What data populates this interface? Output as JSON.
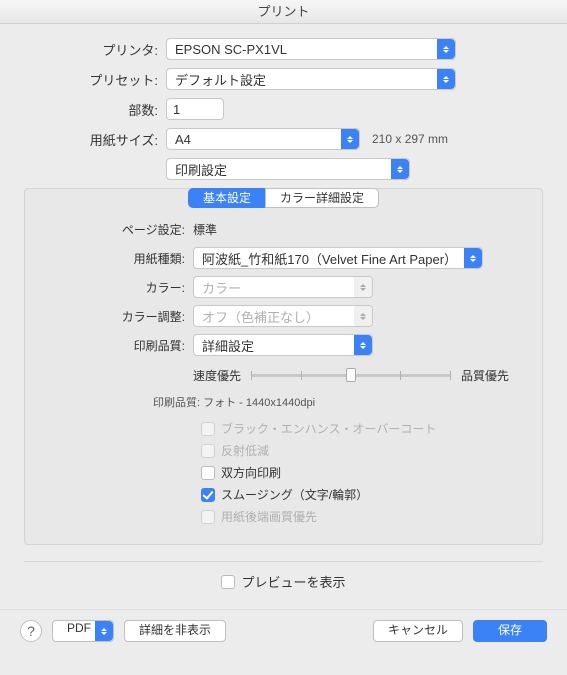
{
  "window": {
    "title": "プリント"
  },
  "labels": {
    "printer": "プリンタ:",
    "preset": "プリセット:",
    "copies": "部数:",
    "paper_size": "用紙サイズ:"
  },
  "printer": {
    "value": "EPSON SC-PX1VL"
  },
  "preset": {
    "value": "デフォルト設定"
  },
  "copies": {
    "value": "1"
  },
  "paper_size": {
    "value": "A4",
    "dimensions": "210 x 297 mm"
  },
  "section_select": {
    "value": "印刷設定"
  },
  "tabs": {
    "basic": "基本設定",
    "color_detail": "カラー詳細設定",
    "active": "basic"
  },
  "panel": {
    "page_setting": {
      "label": "ページ設定:",
      "value": "標準"
    },
    "media_type": {
      "label": "用紙種類:",
      "value": "阿波紙_竹和紙170（Velvet Fine Art Paper）"
    },
    "color": {
      "label": "カラー:",
      "value": "カラー"
    },
    "color_adjust": {
      "label": "カラー調整:",
      "value": "オフ（色補正なし）"
    },
    "print_quality": {
      "label": "印刷品質:",
      "value": "詳細設定"
    },
    "slider": {
      "left": "速度優先",
      "right": "品質優先",
      "position_pct": 50,
      "ticks": 5
    },
    "quality_note": "印刷品質:  フォト - 1440x1440dpi",
    "checks": [
      {
        "label": "ブラック・エンハンス・オーバーコート",
        "checked": false,
        "disabled": true
      },
      {
        "label": "反射低減",
        "checked": false,
        "disabled": true
      },
      {
        "label": "双方向印刷",
        "checked": false,
        "disabled": false
      },
      {
        "label": "スムージング（文字/輪郭）",
        "checked": true,
        "disabled": false
      },
      {
        "label": "用紙後端画質優先",
        "checked": false,
        "disabled": true
      }
    ]
  },
  "show_preview": {
    "label": "プレビューを表示",
    "checked": false
  },
  "footer": {
    "help": "?",
    "pdf": "PDF",
    "detail_toggle": "詳細を非表示",
    "cancel": "キャンセル",
    "save": "保存"
  }
}
